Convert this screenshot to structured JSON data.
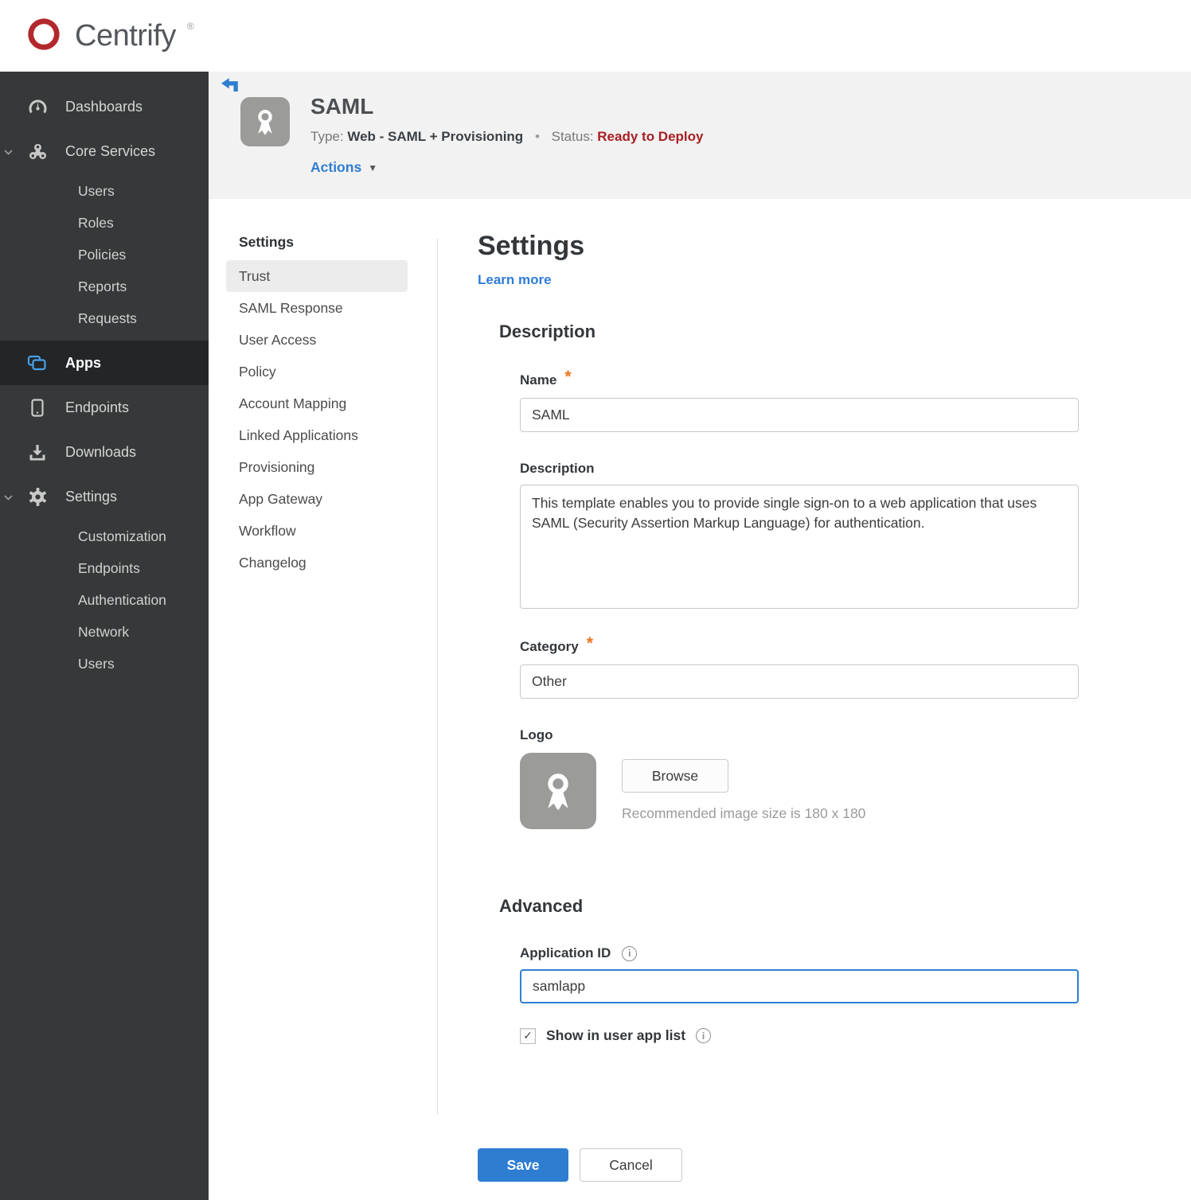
{
  "brand": {
    "name": "Centrify",
    "reg": "®"
  },
  "colors": {
    "brand_red": "#b3282d",
    "link_blue": "#2e7dd1",
    "status_red": "#a81e22",
    "required_orange": "#ee7420",
    "sidebar_bg": "#363839",
    "header_bg": "#f2f2f2"
  },
  "sidebar": {
    "dashboards_label": "Dashboards",
    "core_services_label": "Core Services",
    "core_services_items": [
      "Users",
      "Roles",
      "Policies",
      "Reports",
      "Requests"
    ],
    "apps_label": "Apps",
    "endpoints_label": "Endpoints",
    "downloads_label": "Downloads",
    "settings_label": "Settings",
    "settings_items": [
      "Customization",
      "Endpoints",
      "Authentication",
      "Network",
      "Users"
    ]
  },
  "header": {
    "title": "SAML",
    "type_label": "Type:",
    "type_value": "Web - SAML + Provisioning",
    "separator": "•",
    "status_label": "Status:",
    "status_value": "Ready to Deploy",
    "actions_label": "Actions",
    "actions_caret": "▼"
  },
  "subnav": {
    "title": "Settings",
    "active": "Trust",
    "items": [
      "Trust",
      "SAML Response",
      "User Access",
      "Policy",
      "Account Mapping",
      "Linked Applications",
      "Provisioning",
      "App Gateway",
      "Workflow",
      "Changelog"
    ]
  },
  "main": {
    "title": "Settings",
    "learn_more": "Learn more",
    "required_marker": "*",
    "info_glyph": "i",
    "description": {
      "title": "Description",
      "name_label": "Name",
      "name_value": "SAML",
      "description_label": "Description",
      "description_value": "This template enables you to provide single sign-on to a web application that uses SAML (Security Assertion Markup Language) for authentication.",
      "category_label": "Category",
      "category_value": "Other",
      "logo_label": "Logo",
      "browse_label": "Browse",
      "logo_hint": "Recommended image size is 180 x 180"
    },
    "advanced": {
      "title": "Advanced",
      "app_id_label": "Application ID",
      "app_id_value": "samlapp",
      "show_label": "Show in user app list",
      "checkbox_checked": true,
      "check_glyph": "✓"
    },
    "footer": {
      "save_label": "Save",
      "cancel_label": "Cancel"
    }
  }
}
